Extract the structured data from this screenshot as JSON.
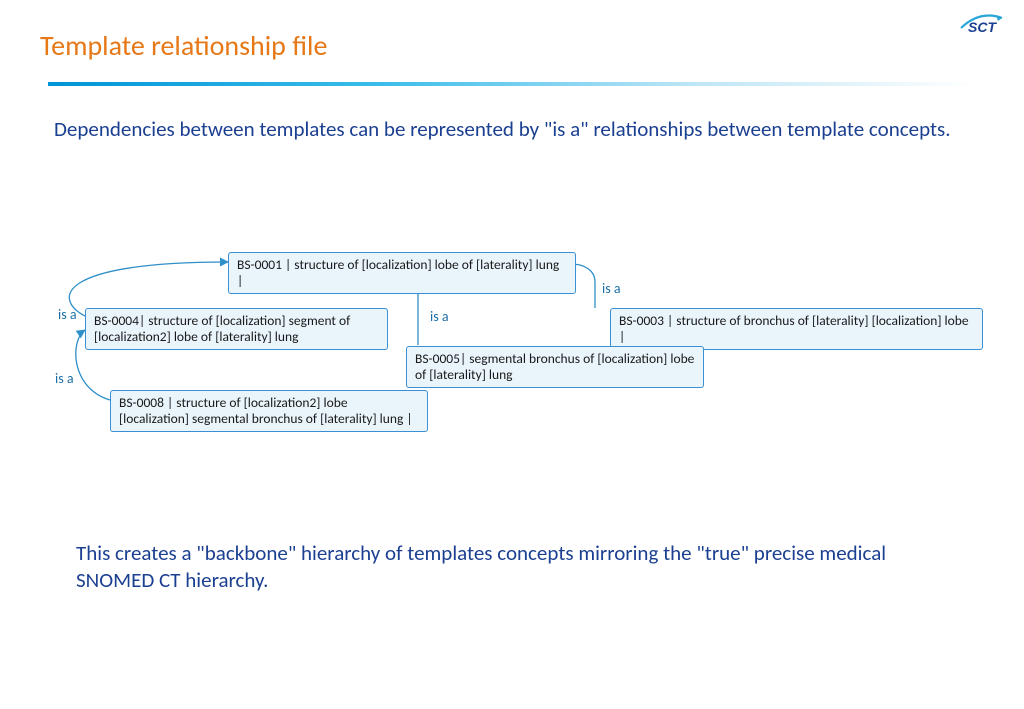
{
  "title": "Template relationship file",
  "logo_text": "SCT",
  "paragraph1": "Dependencies between templates can be represented by  \"is a\" relationships between template concepts.",
  "paragraph2": "This creates a \"backbone\" hierarchy of templates concepts mirroring the \"true\" precise medical SNOMED CT hierarchy.",
  "nodes": {
    "bs0001": "BS-0001 | structure of [localization] lobe of [laterality] lung |",
    "bs0003": "BS-0003 | structure of bronchus of [laterality] [localization] lobe |",
    "bs0004": "BS-0004| structure of [localization] segment of [localization2] lobe of [laterality] lung",
    "bs0005": "BS-0005| segmental bronchus of [localization] lobe of [laterality] lung",
    "bs0008": "BS-0008 | structure of [localization2] lobe [localization] segmental bronchus of [laterality] lung |"
  },
  "isa": "is a"
}
